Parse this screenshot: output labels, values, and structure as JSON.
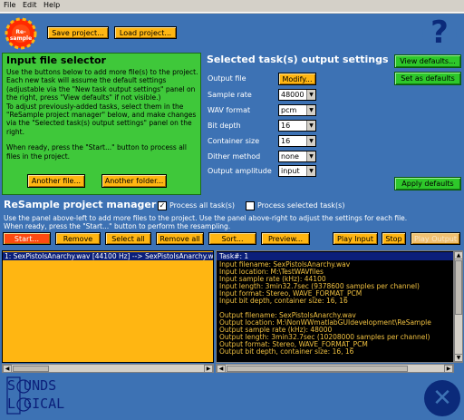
{
  "menu": {
    "file": "File",
    "edit": "Edit",
    "help": "Help"
  },
  "toolbar": {
    "save_project": "Save project...",
    "load_project": "Load project...",
    "logo_text": "Re-sample"
  },
  "help_icon": "?",
  "input_panel": {
    "title": "Input file selector",
    "para1": "Use the buttons below to add more file(s) to the project. Each new task will assume the default settings (adjustable via the \"New task output settings\" panel on the right, press \"View defaults\" if not visible.)",
    "para2": "To adjust previously-added tasks, select them in the \"ReSample project manager\" below, and make changes via the \"Selected task(s) output settings\" panel on the right.",
    "para3": "When ready, press the \"Start...\" button to process all files in the project.",
    "another_file": "Another file...",
    "another_folder": "Another folder..."
  },
  "settings": {
    "title": "Selected task(s) output settings",
    "view_defaults": "View defaults...",
    "set_as_defaults": "Set as defaults",
    "apply_defaults": "Apply defaults",
    "output_file_label": "Output file",
    "modify": "Modify...",
    "sample_rate_label": "Sample rate",
    "sample_rate_value": "48000",
    "wav_format_label": "WAV format",
    "wav_format_value": "pcm",
    "bit_depth_label": "Bit depth",
    "bit_depth_value": "16",
    "container_size_label": "Container size",
    "container_size_value": "16",
    "dither_label": "Dither method",
    "dither_value": "none",
    "amplitude_label": "Output amplitude",
    "amplitude_value": "input"
  },
  "project_manager": {
    "title": "ReSample project manager",
    "process_all": "Process all task(s)",
    "process_all_checked": true,
    "process_selected": "Process selected task(s)",
    "process_selected_checked": false,
    "help_line1": "Use the panel above-left to add more files to the project. Use the panel above-right to adjust the settings for each file.",
    "help_line2": "When ready, press the \"Start...\" button to perform the resampling.",
    "buttons": {
      "start": "Start...",
      "remove": "Remove",
      "select_all": "Select all",
      "remove_all": "Remove all",
      "sort": "Sort...",
      "preview": "Preview...",
      "play_input": "Play Input",
      "stop": "Stop",
      "play_output": "Play Output"
    },
    "tasks": [
      "1: SexPistolsAnarchy.wav [44100 Hz]  -->  SexPistolsAnarchy.wav [48000 Hz]"
    ],
    "task_info": {
      "header": "Task#: 1",
      "lines1": [
        "Input filename: SexPistolsAnarchy.wav",
        "Input location: M:\\TestWAVfiles",
        "Input sample rate (kHz): 44100",
        "Input length: 3min32.7sec (9378600 samples per channel)",
        "Input format: Stereo, WAVE_FORMAT_PCM",
        "Input bit depth, container size: 16, 16"
      ],
      "lines2": [
        "Output filename: SexPistolsAnarchy.wav",
        "Output location: M:\\NonWWmatlabGUIdevelopment\\ReSample",
        "Output sample rate (kHz): 48000",
        "Output length: 3min32.7sec (10208000 samples per channel)",
        "Output format: Stereo, WAVE_FORMAT_PCM",
        "Output bit depth, container size: 16, 16"
      ]
    }
  },
  "footer": {
    "logo_line1": "S  UNDS",
    "logo_line2": "L  GICAL",
    "close_icon": "✕"
  },
  "colors": {
    "app_bg": "#3d72b4",
    "button": "#ffb612",
    "start_button": "#ff4a10",
    "green_panel": "#3fc83a",
    "list_selection": "#0b1f7a",
    "info_text": "#f0c040"
  }
}
